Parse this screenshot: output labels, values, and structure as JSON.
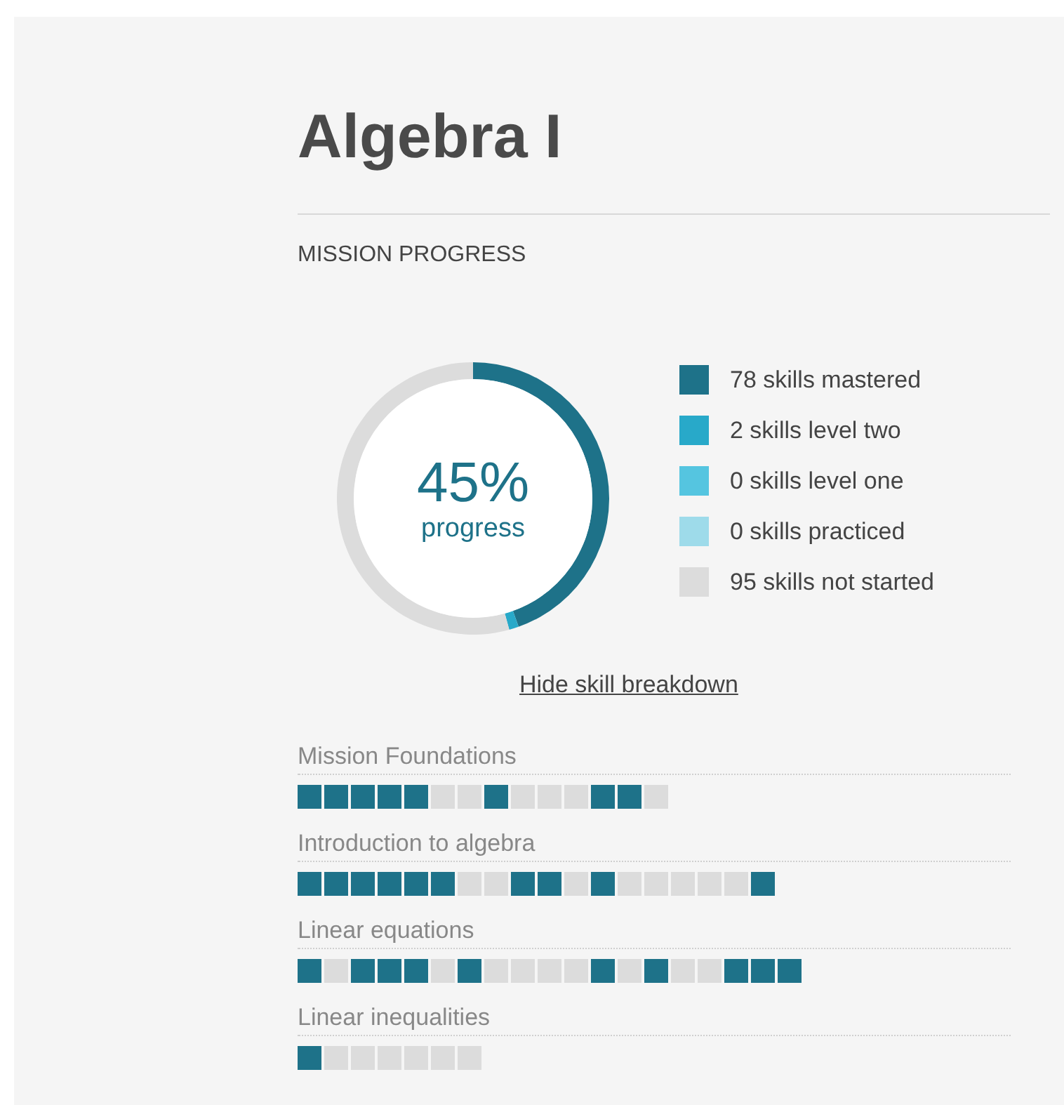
{
  "title": "Algebra I",
  "section_heading": "MISSION PROGRESS",
  "progress": {
    "percent": "45%",
    "caption": "progress",
    "chart_data": {
      "type": "donut",
      "categories": [
        "78 skills mastered",
        "2 skills level two",
        "0 skills level one",
        "0 skills practiced",
        "95 skills not started"
      ],
      "values": [
        78,
        2,
        0,
        0,
        95
      ],
      "colors": [
        "#1e7289",
        "#28a9c9",
        "#55c5e0",
        "#9edbea",
        "#dcdcdc"
      ]
    }
  },
  "toggle_link": "Hide skill breakdown",
  "topics": [
    {
      "name": "Mission Foundations",
      "skills": [
        {
          "mastered": true
        },
        {
          "mastered": true
        },
        {
          "mastered": true
        },
        {
          "mastered": true
        },
        {
          "mastered": true
        },
        {
          "mastered": false
        },
        {
          "mastered": false
        },
        {
          "mastered": true
        },
        {
          "mastered": false
        },
        {
          "mastered": false
        },
        {
          "mastered": false
        },
        {
          "mastered": true
        },
        {
          "mastered": true
        },
        {
          "mastered": false
        }
      ]
    },
    {
      "name": "Introduction to algebra",
      "skills": [
        {
          "mastered": true
        },
        {
          "mastered": true
        },
        {
          "mastered": true
        },
        {
          "mastered": true
        },
        {
          "mastered": true
        },
        {
          "mastered": true
        },
        {
          "mastered": false
        },
        {
          "mastered": false
        },
        {
          "mastered": true
        },
        {
          "mastered": true
        },
        {
          "mastered": false
        },
        {
          "mastered": true
        },
        {
          "mastered": false
        },
        {
          "mastered": false
        },
        {
          "mastered": false
        },
        {
          "mastered": false
        },
        {
          "mastered": false
        },
        {
          "mastered": true
        }
      ]
    },
    {
      "name": "Linear equations",
      "skills": [
        {
          "mastered": true
        },
        {
          "mastered": false
        },
        {
          "mastered": true
        },
        {
          "mastered": true
        },
        {
          "mastered": true
        },
        {
          "mastered": false
        },
        {
          "mastered": true
        },
        {
          "mastered": false
        },
        {
          "mastered": false
        },
        {
          "mastered": false
        },
        {
          "mastered": false
        },
        {
          "mastered": true
        },
        {
          "mastered": false
        },
        {
          "mastered": true
        },
        {
          "mastered": false
        },
        {
          "mastered": false
        },
        {
          "mastered": true
        },
        {
          "mastered": true
        },
        {
          "mastered": true
        }
      ]
    },
    {
      "name": "Linear inequalities",
      "skills": [
        {
          "mastered": true
        },
        {
          "mastered": false
        },
        {
          "mastered": false
        },
        {
          "mastered": false
        },
        {
          "mastered": false
        },
        {
          "mastered": false
        },
        {
          "mastered": false
        }
      ]
    }
  ]
}
